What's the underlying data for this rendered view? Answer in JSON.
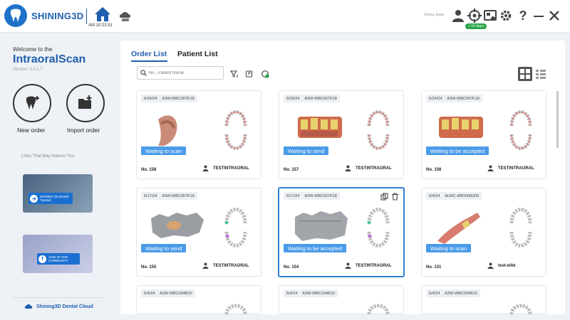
{
  "header": {
    "brand": "SHINING3D",
    "clock": "AM 10:23:51",
    "user_name": "Zhang Jiwan",
    "days_badge": "+ 10 days"
  },
  "sidebar": {
    "welcome": "Welcome to the",
    "app_name": "IntraoralScan",
    "version": "Version: 3.4.1.7",
    "new_order": "New order",
    "import_order": "Import order",
    "links_title": "Links That May Interest You:",
    "promo1": "SHINING 3D Dental Tutorial",
    "promo2": "JOIN IN OUR COMMUNITY",
    "cloud_link": "Shining3D Dental Cloud"
  },
  "main": {
    "tabs": [
      {
        "label": "Order List"
      },
      {
        "label": "Patient List"
      }
    ],
    "search_placeholder": "No., Patient Name"
  },
  "orders": [
    {
      "date": "6/24/24",
      "code": "A3W-WBC007K18",
      "status": "Waiting to scan",
      "no": "No. 158",
      "patient": "TESTINTRAORAL"
    },
    {
      "date": "6/24/24",
      "code": "A3W-WBC007K18",
      "status": "Waiting to send",
      "no": "No. 157",
      "patient": "TESTINTRAORAL"
    },
    {
      "date": "6/24/24",
      "code": "A3W-WBC007K18",
      "status": "Waiting to be accepted",
      "no": "No. 156",
      "patient": "TESTINTRAORAL"
    },
    {
      "date": "6/17/24",
      "code": "A3W-WBC007K18",
      "status": "Waiting to send",
      "no": "No. 155",
      "patient": "TESTINTRAORAL"
    },
    {
      "date": "6/17/24",
      "code": "A3W-WBC007K18",
      "status": "Waiting to be accepted",
      "no": "No. 154",
      "patient": "TESTINTRAORAL"
    },
    {
      "date": "6/4/24",
      "code": "ALWC-ABD009D09",
      "status": "Waiting to scan",
      "no": "No. 131",
      "patient": "test-elite"
    },
    {
      "date": "6/4/24",
      "code": "A3W-WBC034B10"
    },
    {
      "date": "6/4/24",
      "code": "A3W-WBC034B10"
    },
    {
      "date": "6/4/24",
      "code": "A3W-WBC034B10"
    }
  ],
  "colors": {
    "brand": "#1e5fae",
    "status_bg": "#4a9be8",
    "selected_border": "#2f7fd3",
    "badge": "#27a447"
  }
}
